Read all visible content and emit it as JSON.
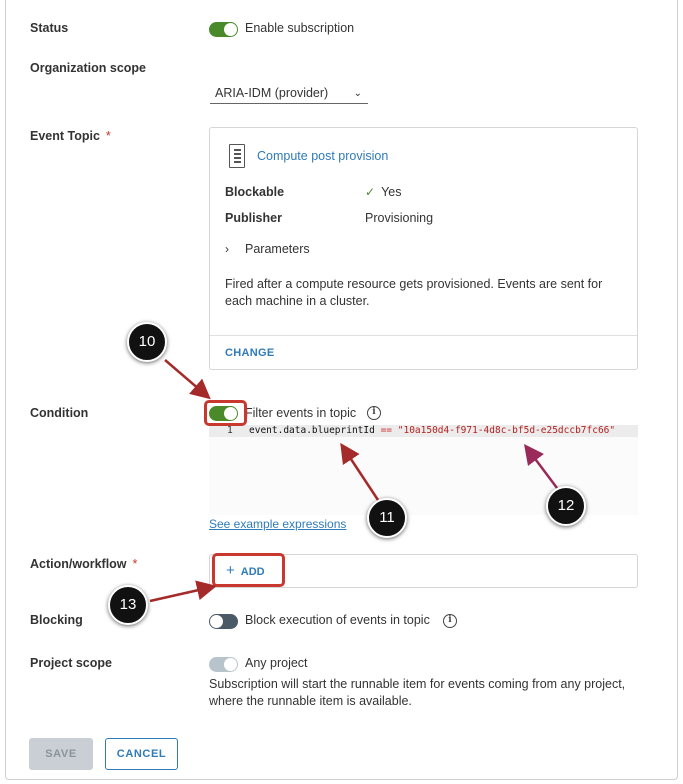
{
  "status": {
    "label": "Status",
    "toggle_label": "Enable subscription",
    "enabled": true
  },
  "organization_scope": {
    "label": "Organization scope",
    "selected": "ARIA-IDM (provider)"
  },
  "event_topic": {
    "label": "Event Topic",
    "required_mark": "*",
    "topic_name": "Compute post provision",
    "blockable_label": "Blockable",
    "blockable_value": "Yes",
    "publisher_label": "Publisher",
    "publisher_value": "Provisioning",
    "parameters_label": "Parameters",
    "description": "Fired after a compute resource gets provisioned. Events are sent for each machine in a cluster.",
    "change_label": "CHANGE"
  },
  "condition": {
    "label": "Condition",
    "toggle_label": "Filter events in topic",
    "enabled": true,
    "line_number": "1",
    "code_field": "event.data.blueprintId",
    "code_operator": "==",
    "code_value": "\"10a150d4-f971-4d8c-bf5d-e25dccb7fc66\"",
    "example_link": "See example expressions"
  },
  "action_workflow": {
    "label": "Action/workflow",
    "required_mark": "*",
    "add_label": "ADD"
  },
  "blocking": {
    "label": "Blocking",
    "toggle_label": "Block execution of events in topic",
    "enabled": false
  },
  "project_scope": {
    "label": "Project scope",
    "toggle_label": "Any project",
    "enabled": true,
    "helper_text": "Subscription will start the runnable item for events coming from any project, where the runnable item is available."
  },
  "buttons": {
    "save": "SAVE",
    "cancel": "CANCEL"
  },
  "callouts": [
    "10",
    "11",
    "12",
    "13"
  ],
  "colors": {
    "accent": "#2f7bb8",
    "toggle_on": "#4a8a2a",
    "highlight": "#c8382f",
    "required": "#c0392b"
  }
}
